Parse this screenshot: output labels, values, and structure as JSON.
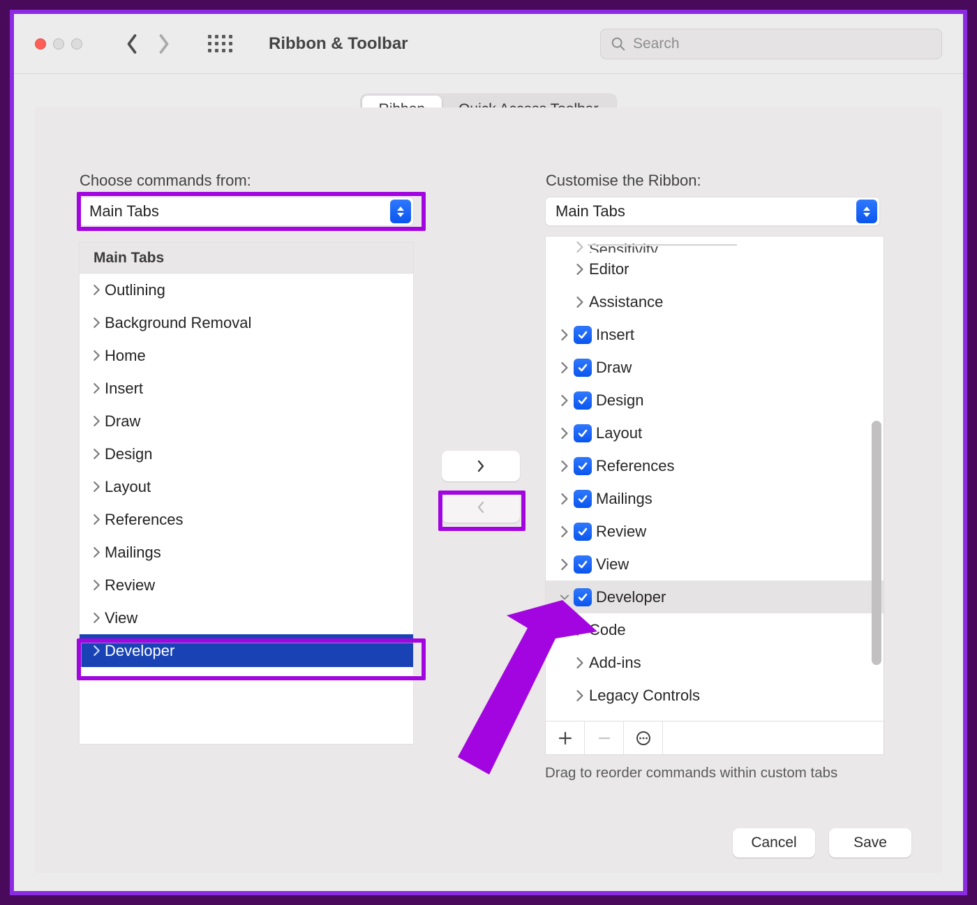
{
  "window": {
    "title": "Ribbon & Toolbar",
    "search_placeholder": "Search"
  },
  "tabs": {
    "ribbon": "Ribbon",
    "quick_access": "Quick Access Toolbar",
    "active": "ribbon"
  },
  "left": {
    "label": "Choose commands from:",
    "dropdown_value": "Main Tabs",
    "list_header": "Main Tabs",
    "items": [
      "Outlining",
      "Background Removal",
      "Home",
      "Insert",
      "Draw",
      "Design",
      "Layout",
      "References",
      "Mailings",
      "Review",
      "View",
      "Developer"
    ],
    "selected_index": 11
  },
  "right": {
    "label": "Customise the Ribbon:",
    "dropdown_value": "Main Tabs",
    "tree": [
      {
        "label": "Sensitivity",
        "level": 1,
        "checked": null,
        "expanded": false,
        "clipped": true
      },
      {
        "label": "Editor",
        "level": 1,
        "checked": null,
        "expanded": false
      },
      {
        "label": "Assistance",
        "level": 1,
        "checked": null,
        "expanded": false
      },
      {
        "label": "Insert",
        "level": 0,
        "checked": true,
        "expanded": false
      },
      {
        "label": "Draw",
        "level": 0,
        "checked": true,
        "expanded": false
      },
      {
        "label": "Design",
        "level": 0,
        "checked": true,
        "expanded": false
      },
      {
        "label": "Layout",
        "level": 0,
        "checked": true,
        "expanded": false
      },
      {
        "label": "References",
        "level": 0,
        "checked": true,
        "expanded": false
      },
      {
        "label": "Mailings",
        "level": 0,
        "checked": true,
        "expanded": false
      },
      {
        "label": "Review",
        "level": 0,
        "checked": true,
        "expanded": false
      },
      {
        "label": "View",
        "level": 0,
        "checked": true,
        "expanded": false
      },
      {
        "label": "Developer",
        "level": 0,
        "checked": true,
        "expanded": true,
        "selected": true
      },
      {
        "label": "Code",
        "level": 1,
        "checked": null,
        "expanded": false
      },
      {
        "label": "Add-ins",
        "level": 1,
        "checked": null,
        "expanded": false
      },
      {
        "label": "Legacy Controls",
        "level": 1,
        "checked": null,
        "expanded": false
      }
    ],
    "footer_hint": "Drag to reorder commands within custom tabs"
  },
  "buttons": {
    "cancel": "Cancel",
    "save": "Save"
  }
}
